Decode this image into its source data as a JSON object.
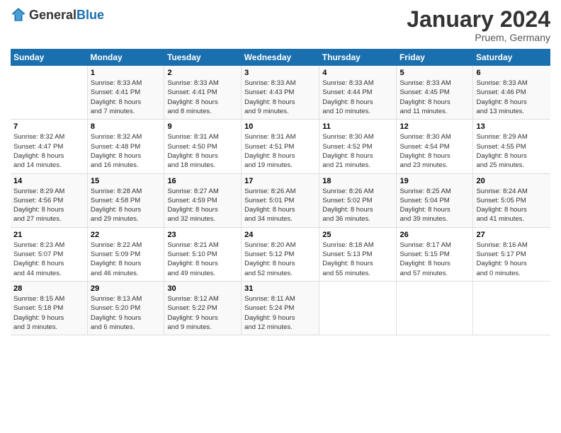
{
  "header": {
    "logo_general": "General",
    "logo_blue": "Blue",
    "month": "January 2024",
    "location": "Pruem, Germany"
  },
  "weekdays": [
    "Sunday",
    "Monday",
    "Tuesday",
    "Wednesday",
    "Thursday",
    "Friday",
    "Saturday"
  ],
  "weeks": [
    [
      {
        "day": "",
        "info": ""
      },
      {
        "day": "1",
        "info": "Sunrise: 8:33 AM\nSunset: 4:41 PM\nDaylight: 8 hours\nand 7 minutes."
      },
      {
        "day": "2",
        "info": "Sunrise: 8:33 AM\nSunset: 4:41 PM\nDaylight: 8 hours\nand 8 minutes."
      },
      {
        "day": "3",
        "info": "Sunrise: 8:33 AM\nSunset: 4:43 PM\nDaylight: 8 hours\nand 9 minutes."
      },
      {
        "day": "4",
        "info": "Sunrise: 8:33 AM\nSunset: 4:44 PM\nDaylight: 8 hours\nand 10 minutes."
      },
      {
        "day": "5",
        "info": "Sunrise: 8:33 AM\nSunset: 4:45 PM\nDaylight: 8 hours\nand 11 minutes."
      },
      {
        "day": "6",
        "info": "Sunrise: 8:33 AM\nSunset: 4:46 PM\nDaylight: 8 hours\nand 13 minutes."
      }
    ],
    [
      {
        "day": "7",
        "info": "Sunrise: 8:32 AM\nSunset: 4:47 PM\nDaylight: 8 hours\nand 14 minutes."
      },
      {
        "day": "8",
        "info": "Sunrise: 8:32 AM\nSunset: 4:48 PM\nDaylight: 8 hours\nand 16 minutes."
      },
      {
        "day": "9",
        "info": "Sunrise: 8:31 AM\nSunset: 4:50 PM\nDaylight: 8 hours\nand 18 minutes."
      },
      {
        "day": "10",
        "info": "Sunrise: 8:31 AM\nSunset: 4:51 PM\nDaylight: 8 hours\nand 19 minutes."
      },
      {
        "day": "11",
        "info": "Sunrise: 8:30 AM\nSunset: 4:52 PM\nDaylight: 8 hours\nand 21 minutes."
      },
      {
        "day": "12",
        "info": "Sunrise: 8:30 AM\nSunset: 4:54 PM\nDaylight: 8 hours\nand 23 minutes."
      },
      {
        "day": "13",
        "info": "Sunrise: 8:29 AM\nSunset: 4:55 PM\nDaylight: 8 hours\nand 25 minutes."
      }
    ],
    [
      {
        "day": "14",
        "info": "Sunrise: 8:29 AM\nSunset: 4:56 PM\nDaylight: 8 hours\nand 27 minutes."
      },
      {
        "day": "15",
        "info": "Sunrise: 8:28 AM\nSunset: 4:58 PM\nDaylight: 8 hours\nand 29 minutes."
      },
      {
        "day": "16",
        "info": "Sunrise: 8:27 AM\nSunset: 4:59 PM\nDaylight: 8 hours\nand 32 minutes."
      },
      {
        "day": "17",
        "info": "Sunrise: 8:26 AM\nSunset: 5:01 PM\nDaylight: 8 hours\nand 34 minutes."
      },
      {
        "day": "18",
        "info": "Sunrise: 8:26 AM\nSunset: 5:02 PM\nDaylight: 8 hours\nand 36 minutes."
      },
      {
        "day": "19",
        "info": "Sunrise: 8:25 AM\nSunset: 5:04 PM\nDaylight: 8 hours\nand 39 minutes."
      },
      {
        "day": "20",
        "info": "Sunrise: 8:24 AM\nSunset: 5:05 PM\nDaylight: 8 hours\nand 41 minutes."
      }
    ],
    [
      {
        "day": "21",
        "info": "Sunrise: 8:23 AM\nSunset: 5:07 PM\nDaylight: 8 hours\nand 44 minutes."
      },
      {
        "day": "22",
        "info": "Sunrise: 8:22 AM\nSunset: 5:09 PM\nDaylight: 8 hours\nand 46 minutes."
      },
      {
        "day": "23",
        "info": "Sunrise: 8:21 AM\nSunset: 5:10 PM\nDaylight: 8 hours\nand 49 minutes."
      },
      {
        "day": "24",
        "info": "Sunrise: 8:20 AM\nSunset: 5:12 PM\nDaylight: 8 hours\nand 52 minutes."
      },
      {
        "day": "25",
        "info": "Sunrise: 8:18 AM\nSunset: 5:13 PM\nDaylight: 8 hours\nand 55 minutes."
      },
      {
        "day": "26",
        "info": "Sunrise: 8:17 AM\nSunset: 5:15 PM\nDaylight: 8 hours\nand 57 minutes."
      },
      {
        "day": "27",
        "info": "Sunrise: 8:16 AM\nSunset: 5:17 PM\nDaylight: 9 hours\nand 0 minutes."
      }
    ],
    [
      {
        "day": "28",
        "info": "Sunrise: 8:15 AM\nSunset: 5:18 PM\nDaylight: 9 hours\nand 3 minutes."
      },
      {
        "day": "29",
        "info": "Sunrise: 8:13 AM\nSunset: 5:20 PM\nDaylight: 9 hours\nand 6 minutes."
      },
      {
        "day": "30",
        "info": "Sunrise: 8:12 AM\nSunset: 5:22 PM\nDaylight: 9 hours\nand 9 minutes."
      },
      {
        "day": "31",
        "info": "Sunrise: 8:11 AM\nSunset: 5:24 PM\nDaylight: 9 hours\nand 12 minutes."
      },
      {
        "day": "",
        "info": ""
      },
      {
        "day": "",
        "info": ""
      },
      {
        "day": "",
        "info": ""
      }
    ]
  ]
}
